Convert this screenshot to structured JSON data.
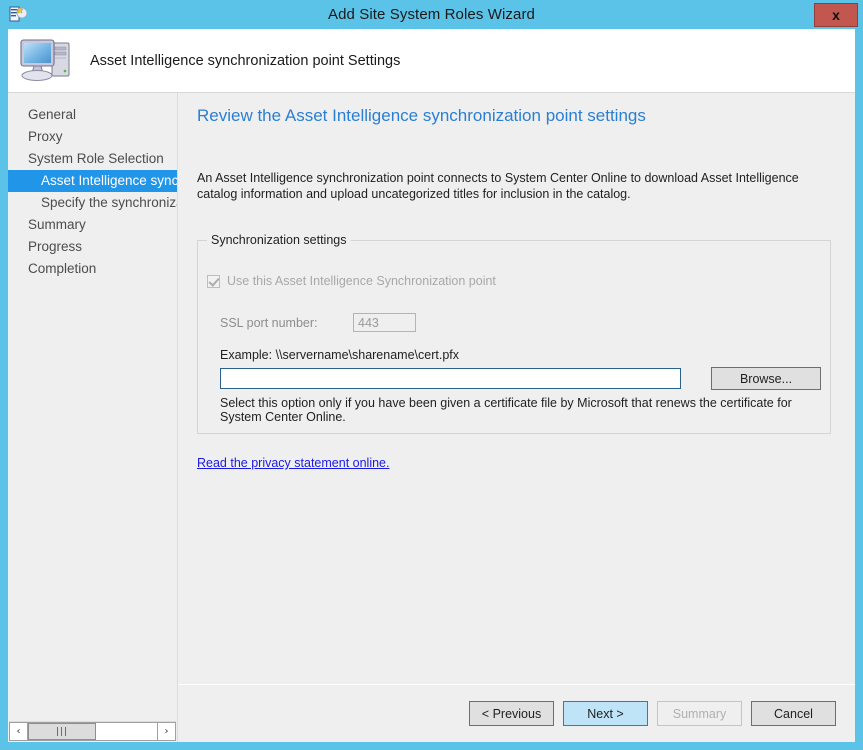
{
  "window": {
    "title": "Add Site System Roles Wizard",
    "close_label": "x",
    "titlebar_color": "#5bc3e8",
    "accent_color": "#2196e8",
    "close_button_color": "#c1574f"
  },
  "header": {
    "title": "Asset Intelligence synchronization point Settings",
    "icon": "computer-icon"
  },
  "sidebar": {
    "items": [
      {
        "label": "General",
        "level": 0,
        "active": false
      },
      {
        "label": "Proxy",
        "level": 0,
        "active": false
      },
      {
        "label": "System Role Selection",
        "level": 0,
        "active": false
      },
      {
        "label": "Asset Intelligence synchronization point",
        "level": 1,
        "active": true
      },
      {
        "label": "Specify the synchronization schedule",
        "level": 1,
        "active": false
      },
      {
        "label": "Summary",
        "level": 0,
        "active": false
      },
      {
        "label": "Progress",
        "level": 0,
        "active": false
      },
      {
        "label": "Completion",
        "level": 0,
        "active": false
      }
    ],
    "scrollbar": {
      "left_arrow": "‹",
      "right_arrow": "›",
      "thumb_grip": "|||"
    }
  },
  "main": {
    "page_title": "Review the Asset Intelligence synchronization point settings",
    "intro_text": "An Asset Intelligence synchronization point connects to System Center Online to download Asset Intelligence catalog information and upload uncategorized titles for inclusion in the catalog.",
    "group": {
      "legend": "Synchronization settings",
      "use_point_checkbox": {
        "label": "Use this Asset Intelligence Synchronization point",
        "checked": true,
        "enabled": false
      },
      "ssl_port": {
        "label": "SSL port number:",
        "value": "443",
        "enabled": false
      },
      "example_label": "Example: \\\\servername\\sharename\\cert.pfx",
      "path_input": {
        "value": "",
        "placeholder": "",
        "focused": true
      },
      "browse_label": "Browse...",
      "hint_text": "Select this option only if you have been given a certificate file by Microsoft that renews the certificate for System Center Online."
    },
    "privacy_link": "Read the privacy statement online."
  },
  "footer": {
    "previous_label": "< Previous",
    "next_label": "Next >",
    "summary_label": "Summary",
    "cancel_label": "Cancel",
    "next_is_default": true,
    "summary_disabled": true
  }
}
